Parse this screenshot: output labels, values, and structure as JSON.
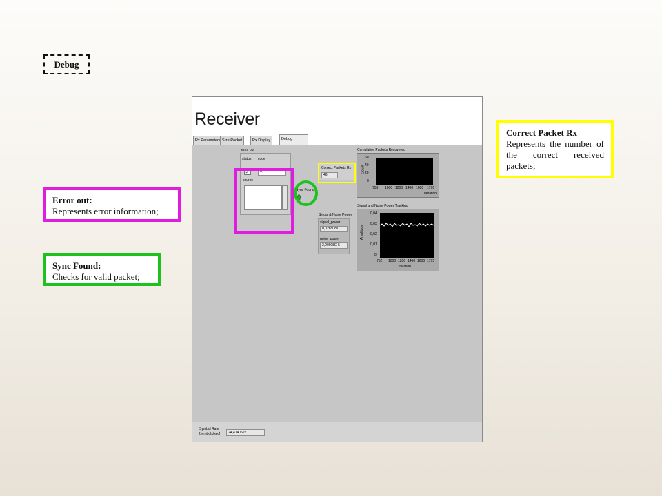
{
  "debug_tag": "Debug",
  "callouts": {
    "error": {
      "title": "Error out:",
      "text": "Represents error information;"
    },
    "sync": {
      "title": "Sync Found:",
      "text": "Checks for valid packet;"
    },
    "packets": {
      "title": "Correct Packet Rx",
      "text": "Represents the number of the correct received packets;"
    }
  },
  "panel": {
    "title": "Receiver",
    "tabs": [
      "Rx Parameters",
      "Size Packet",
      "Rx Display",
      "Debug"
    ],
    "active_tab": "Debug",
    "error_out": {
      "label": "error out",
      "status_label": "status",
      "code_label": "code",
      "code_value": "0",
      "source_label": "source",
      "status_icon": "check-icon",
      "status_color": "#2b9a2b"
    },
    "sync_found_label": "Sync Found",
    "correct_packets": {
      "label": "Correct Packets Rx",
      "value": "46"
    },
    "power": {
      "title": "Singal & Noise Power",
      "signal_label": "signal_power",
      "signal_value": "0,0265087",
      "noise_label": "noise_power",
      "noise_value": "2,20908E-5"
    },
    "cumulative_graph": {
      "title": "Cumulative Packets Recovered",
      "y_label": "Count",
      "x_label": "Iteration",
      "y_ticks": [
        "60",
        "40",
        "20",
        "0"
      ],
      "x_ticks": [
        "753",
        "1000",
        "1200",
        "1400",
        "1600",
        "1776"
      ]
    },
    "tracking_graph": {
      "title": "Signal and Noise Power Tracking",
      "y_label": "Amplitude",
      "x_label": "Iteration",
      "y_ticks": [
        "0,04",
        "0,03",
        "0,02",
        "0,01",
        "0"
      ],
      "x_ticks": [
        "752",
        "1000",
        "1200",
        "1400",
        "1600",
        "1775"
      ]
    },
    "symbol_rate": {
      "label_line1": "Symbol Rate",
      "label_line2": "[symbols/sec]",
      "value": "24,414062k"
    }
  },
  "colors": {
    "error_highlight": "#e11ce1",
    "sync_highlight": "#1ec21e",
    "packets_highlight": "#ffff00",
    "panel_bg": "#c6c6c6"
  }
}
